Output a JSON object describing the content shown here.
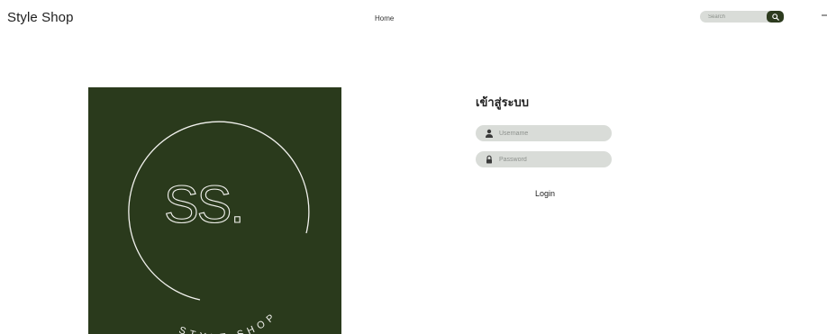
{
  "header": {
    "brand": "Style Shop",
    "nav": {
      "home_label": "Home"
    },
    "search": {
      "placeholder": "Search"
    }
  },
  "logo": {
    "monogram": "SS.",
    "ring_text": "STYLE SHOP",
    "background_color": "#2a3a1c"
  },
  "login": {
    "title": "เข้าสู่ระบบ",
    "username_placeholder": "Username",
    "password_placeholder": "Password",
    "submit_label": "Login"
  },
  "colors": {
    "accent": "#2d3b1f",
    "field_bg": "#d9dcd8"
  }
}
